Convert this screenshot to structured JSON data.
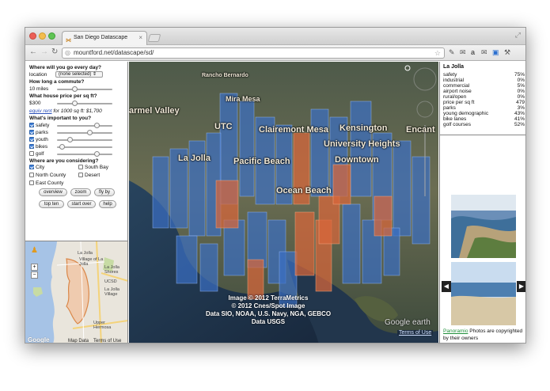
{
  "browser": {
    "tab_title": "San Diego Datascape",
    "url": "mountford.net/datascape/sd/"
  },
  "panel": {
    "q_every_day": "Where will you go every day?",
    "location_label": "location",
    "location_value": "(none selected)",
    "q_commute": "How long a commute?",
    "commute_value": "10 miles",
    "commute_level": 0.3,
    "q_price": "What house price per sq ft?",
    "price_value": "$300",
    "price_level": 0.3,
    "equiv_rent_link": "equiv rent",
    "equiv_rent_text": "for 1000 sq ft: $1,700",
    "q_important": "What's important to you?",
    "priorities": [
      {
        "label": "safety",
        "checked": true,
        "level": 0.75
      },
      {
        "label": "parks",
        "checked": true,
        "level": 0.6
      },
      {
        "label": "youth",
        "checked": true,
        "level": 0.2
      },
      {
        "label": "bikes",
        "checked": true,
        "level": 0.05
      },
      {
        "label": "golf",
        "checked": false,
        "level": 0.75
      }
    ],
    "q_considering": "Where are you considering?",
    "areas": [
      {
        "label": "City",
        "checked": true
      },
      {
        "label": "South Bay",
        "checked": false
      },
      {
        "label": "North County",
        "checked": false
      },
      {
        "label": "Desert",
        "checked": false
      },
      {
        "label": "East County",
        "checked": false
      }
    ],
    "buttons": [
      "overview",
      "zoom",
      "fly by",
      "top ten",
      "start over",
      "help"
    ]
  },
  "minimap": {
    "labels": [
      "La Jolla",
      "Village of La Jolla",
      "La Jolla Shores",
      "UCSD",
      "La Jolla Village",
      "Upper Hermosa"
    ],
    "map_data_link": "Map Data",
    "terms_link": "Terms of Use"
  },
  "earth_view": {
    "places": [
      "Rancho Bernardo",
      "Mira Mesa",
      "armel Valley",
      "UTC",
      "Clairemont Mesa",
      "Kensington",
      "Encant",
      "University Heights",
      "La Jolla",
      "Pacific Beach",
      "Downtown",
      "Ocean Beach"
    ],
    "credits": [
      "Image © 2012 TerraMetrics",
      "© 2012 Cnes/Spot Image",
      "Data SIO, NOAA, U.S. Navy, NGA, GEBCO",
      "Data USGS"
    ],
    "google_earth_logo": "Google earth",
    "terms_link": "Terms of Use"
  },
  "info": {
    "place_name": "La Jolla",
    "stats": [
      {
        "label": "safety",
        "value": "75%"
      },
      {
        "label": "industrial",
        "value": "0%"
      },
      {
        "label": "commercial",
        "value": "5%"
      },
      {
        "label": "airport noise",
        "value": "0%"
      },
      {
        "label": "rural/open",
        "value": "0%"
      },
      {
        "label": "price per sq ft",
        "value": "479"
      },
      {
        "label": "parks",
        "value": "3%"
      },
      {
        "label": "young demographic",
        "value": "43%"
      },
      {
        "label": "bike lanes",
        "value": "41%"
      },
      {
        "label": "golf courses",
        "value": "52%"
      }
    ],
    "panoramio_link": "Panoramio",
    "photo_credit": "Photos are copyrighted by their owners"
  },
  "colors": {
    "blue_blocks": "#3b6fc4",
    "orange_blocks": "#d9663a",
    "link": "#2a4fb8",
    "checkbox_on": "#3d7ed8"
  }
}
